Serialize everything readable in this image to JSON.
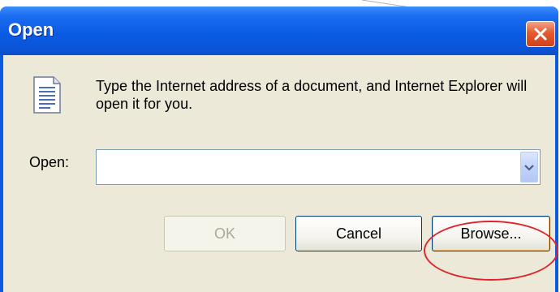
{
  "dialog": {
    "title": "Open",
    "message": "Type the Internet address of a document, and Internet Explorer will open it for you."
  },
  "open_field": {
    "label": "Open:",
    "value": ""
  },
  "buttons": {
    "ok": "OK",
    "cancel": "Cancel",
    "browse": "Browse..."
  },
  "icons": {
    "close": "close-icon",
    "document": "document-icon",
    "dropdown": "chevron-down-icon"
  },
  "colors": {
    "titlebar": "#0b5ce4",
    "client_bg": "#ece9d8",
    "close_button": "#e55a2f",
    "highlight_ring": "#e0242c"
  }
}
